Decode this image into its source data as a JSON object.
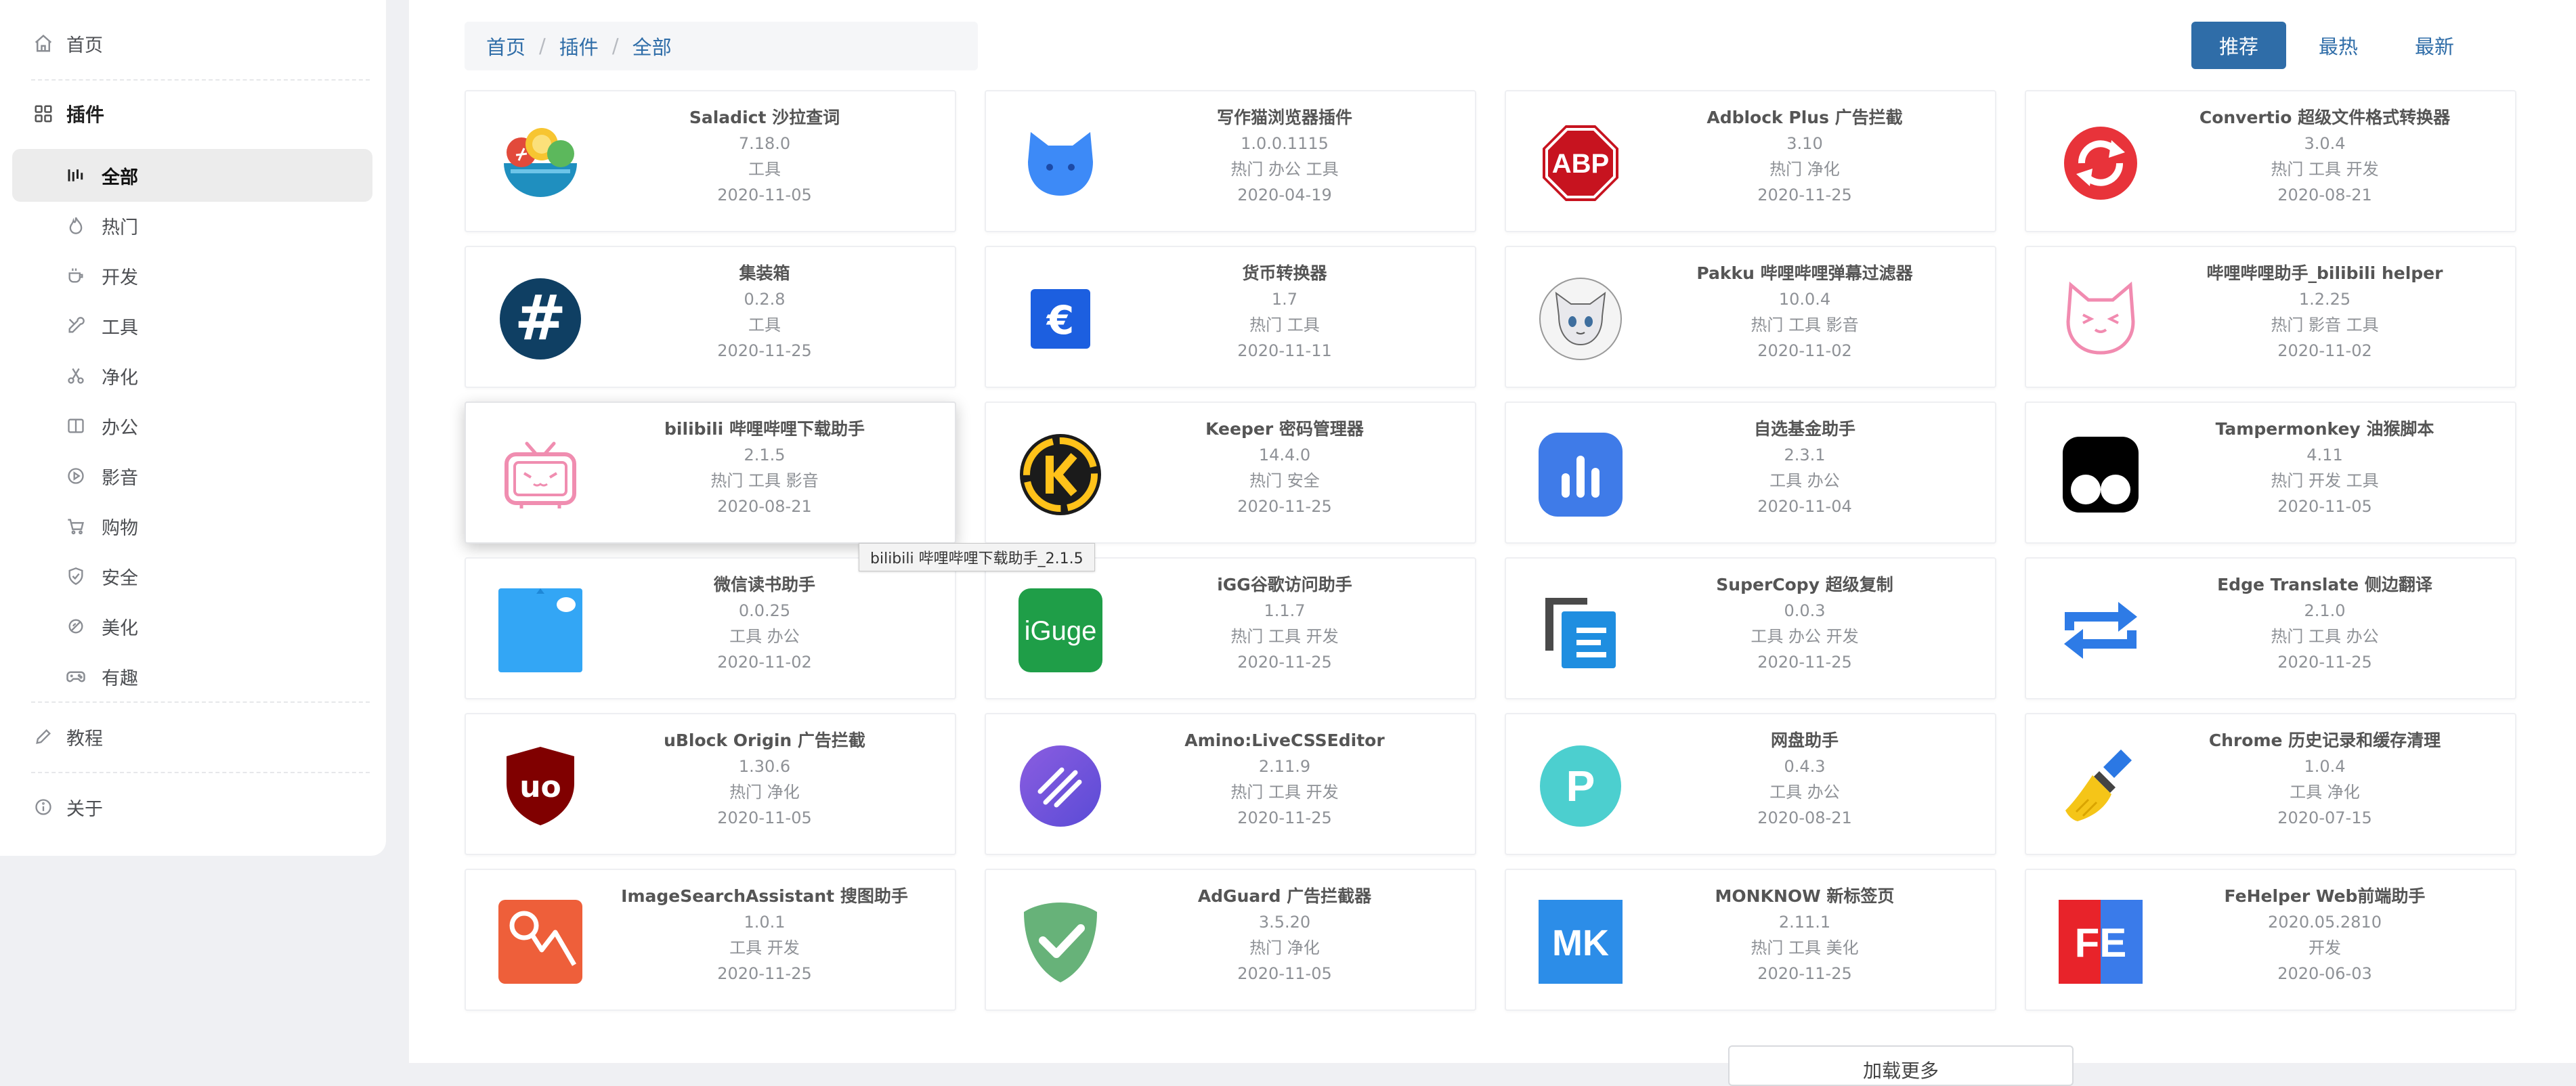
{
  "sidebar": {
    "home": "首页",
    "plugins": "插件",
    "sub_items": [
      {
        "label": "全部",
        "icon": "equalizer-icon"
      },
      {
        "label": "热门",
        "icon": "flame-icon"
      },
      {
        "label": "开发",
        "icon": "coffee-cup-icon"
      },
      {
        "label": "工具",
        "icon": "tools-icon"
      },
      {
        "label": "净化",
        "icon": "scissors-icon"
      },
      {
        "label": "办公",
        "icon": "book-icon"
      },
      {
        "label": "影音",
        "icon": "play-circle-icon"
      },
      {
        "label": "购物",
        "icon": "cart-icon"
      },
      {
        "label": "安全",
        "icon": "shield-icon"
      },
      {
        "label": "美化",
        "icon": "no-eye-icon"
      },
      {
        "label": "有趣",
        "icon": "gamepad-icon"
      }
    ],
    "tutorial": "教程",
    "about": "关于"
  },
  "breadcrumb": [
    "首页",
    "插件",
    "全部"
  ],
  "sort": {
    "recommend": "推荐",
    "hot": "最热",
    "new": "最新"
  },
  "cards": [
    {
      "title": "Saladict 沙拉查词",
      "version": "7.18.0",
      "tags": "工具",
      "date": "2020-11-05",
      "icon": "salad-bowl-icon"
    },
    {
      "title": "写作猫浏览器插件",
      "version": "1.0.0.1115",
      "tags": "热门 办公 工具",
      "date": "2020-04-19",
      "icon": "blue-cat-icon"
    },
    {
      "title": "Adblock Plus 广告拦截",
      "version": "3.10",
      "tags": "热门 净化",
      "date": "2020-11-25",
      "icon": "abp-stop-sign-icon",
      "logo_text": "ABP"
    },
    {
      "title": "Convertio 超级文件格式转换器",
      "version": "3.0.4",
      "tags": "热门 工具 开发",
      "date": "2020-08-21",
      "icon": "convert-circle-icon"
    },
    {
      "title": "集装箱",
      "version": "0.2.8",
      "tags": "工具",
      "date": "2020-11-25",
      "icon": "hashtag-circle-icon",
      "logo_text": "#"
    },
    {
      "title": "货币转换器",
      "version": "1.7",
      "tags": "热门 工具",
      "date": "2020-11-11",
      "icon": "euro-icon",
      "logo_text": "€"
    },
    {
      "title": "Pakku 哔哩哔哩弹幕过滤器",
      "version": "10.0.4",
      "tags": "热门 工具 影音",
      "date": "2020-11-02",
      "icon": "anime-cat-icon"
    },
    {
      "title": "哔哩哔哩助手_bilibili helper",
      "version": "1.2.25",
      "tags": "热门 影音 工具",
      "date": "2020-11-02",
      "icon": "pink-cat-outline-icon"
    },
    {
      "title": "bilibili 哔哩哔哩下载助手",
      "version": "2.1.5",
      "tags": "热门 工具 影音",
      "date": "2020-08-21",
      "icon": "bilibili-tv-icon"
    },
    {
      "title": "Keeper 密码管理器",
      "version": "14.4.0",
      "tags": "热门 安全",
      "date": "2020-11-25",
      "icon": "keeper-icon"
    },
    {
      "title": "自选基金助手",
      "version": "2.3.1",
      "tags": "工具 办公",
      "date": "2020-11-04",
      "icon": "bar-chart-icon"
    },
    {
      "title": "Tampermonkey 油猴脚本",
      "version": "4.11",
      "tags": "热门 开发 工具",
      "date": "2020-11-05",
      "icon": "tampermonkey-icon"
    },
    {
      "title": "微信读书助手",
      "version": "0.0.25",
      "tags": "工具 办公",
      "date": "2020-11-02",
      "icon": "wechat-read-icon"
    },
    {
      "title": "iGG谷歌访问助手",
      "version": "1.1.7",
      "tags": "热门 工具 开发",
      "date": "2020-11-25",
      "icon": "iguge-icon",
      "logo_text": "iGuge"
    },
    {
      "title": "SuperCopy 超级复制",
      "version": "0.0.3",
      "tags": "工具 办公 开发",
      "date": "2020-11-25",
      "icon": "copy-document-icon"
    },
    {
      "title": "Edge Translate 侧边翻译",
      "version": "2.1.0",
      "tags": "热门 工具 办公",
      "date": "2020-11-25",
      "icon": "swap-arrows-icon"
    },
    {
      "title": "uBlock Origin 广告拦截",
      "version": "1.30.6",
      "tags": "热门 净化",
      "date": "2020-11-05",
      "icon": "ublock-shield-icon",
      "logo_text": "uo"
    },
    {
      "title": "Amino:LiveCSSEditor",
      "version": "2.11.9",
      "tags": "热门 工具 开发",
      "date": "2020-11-25",
      "icon": "amino-icon"
    },
    {
      "title": "网盘助手",
      "version": "0.4.3",
      "tags": "工具 办公",
      "date": "2020-08-21",
      "icon": "p-circle-icon",
      "logo_text": "P"
    },
    {
      "title": "Chrome 历史记录和缓存清理",
      "version": "1.0.4",
      "tags": "工具 净化",
      "date": "2020-07-15",
      "icon": "broom-icon"
    },
    {
      "title": "ImageSearchAssistant 搜图助手",
      "version": "1.0.1",
      "tags": "工具 开发",
      "date": "2020-11-25",
      "icon": "image-search-icon"
    },
    {
      "title": "AdGuard 广告拦截器",
      "version": "3.5.20",
      "tags": "热门 净化",
      "date": "2020-11-05",
      "icon": "adguard-shield-icon"
    },
    {
      "title": "MONKNOW 新标签页",
      "version": "2.11.1",
      "tags": "热门 工具 美化",
      "date": "2020-11-25",
      "icon": "monknow-icon",
      "logo_text": "MK"
    },
    {
      "title": "FeHelper Web前端助手",
      "version": "2020.05.2810",
      "tags": "开发",
      "date": "2020-06-03",
      "icon": "fehelper-icon",
      "logo_text": "FE"
    }
  ],
  "tooltip": "bilibili 哔哩哔哩下载助手_2.1.5",
  "load_more": "加载更多",
  "colors": {
    "accent": "#2f6da8",
    "active_bg": "#ececec"
  }
}
